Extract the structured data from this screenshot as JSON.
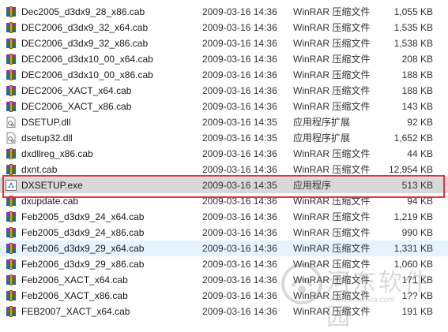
{
  "files": [
    {
      "name": "Dec2005_d3dx9_28_x86.cab",
      "date": "2009-03-16 14:36",
      "type": "WinRAR 压缩文件",
      "size": "1,055 KB",
      "icon": "winrar-archive-icon",
      "state": ""
    },
    {
      "name": "DEC2006_d3dx9_32_x64.cab",
      "date": "2009-03-16 14:36",
      "type": "WinRAR 压缩文件",
      "size": "1,535 KB",
      "icon": "winrar-archive-icon",
      "state": ""
    },
    {
      "name": "DEC2006_d3dx9_32_x86.cab",
      "date": "2009-03-16 14:36",
      "type": "WinRAR 压缩文件",
      "size": "1,538 KB",
      "icon": "winrar-archive-icon",
      "state": ""
    },
    {
      "name": "DEC2006_d3dx10_00_x64.cab",
      "date": "2009-03-16 14:36",
      "type": "WinRAR 压缩文件",
      "size": "208 KB",
      "icon": "winrar-archive-icon",
      "state": ""
    },
    {
      "name": "DEC2006_d3dx10_00_x86.cab",
      "date": "2009-03-16 14:36",
      "type": "WinRAR 压缩文件",
      "size": "188 KB",
      "icon": "winrar-archive-icon",
      "state": ""
    },
    {
      "name": "DEC2006_XACT_x64.cab",
      "date": "2009-03-16 14:36",
      "type": "WinRAR 压缩文件",
      "size": "188 KB",
      "icon": "winrar-archive-icon",
      "state": ""
    },
    {
      "name": "DEC2006_XACT_x86.cab",
      "date": "2009-03-16 14:36",
      "type": "WinRAR 压缩文件",
      "size": "143 KB",
      "icon": "winrar-archive-icon",
      "state": ""
    },
    {
      "name": "DSETUP.dll",
      "date": "2009-03-16 14:35",
      "type": "应用程序扩展",
      "size": "92 KB",
      "icon": "dll-file-icon",
      "state": ""
    },
    {
      "name": "dsetup32.dll",
      "date": "2009-03-16 14:35",
      "type": "应用程序扩展",
      "size": "1,652 KB",
      "icon": "dll-file-icon",
      "state": ""
    },
    {
      "name": "dxdllreg_x86.cab",
      "date": "2009-03-16 14:36",
      "type": "WinRAR 压缩文件",
      "size": "44 KB",
      "icon": "winrar-archive-icon",
      "state": ""
    },
    {
      "name": "dxnt.cab",
      "date": "2009-03-16 14:36",
      "type": "WinRAR 压缩文件",
      "size": "12,954 KB",
      "icon": "winrar-archive-icon",
      "state": ""
    },
    {
      "name": "DXSETUP.exe",
      "date": "2009-03-16 14:35",
      "type": "应用程序",
      "size": "513 KB",
      "icon": "dxsetup-exe-icon",
      "state": "selected"
    },
    {
      "name": "dxupdate.cab",
      "date": "2009-03-16 14:36",
      "type": "WinRAR 压缩文件",
      "size": "94 KB",
      "icon": "winrar-archive-icon",
      "state": ""
    },
    {
      "name": "Feb2005_d3dx9_24_x64.cab",
      "date": "2009-03-16 14:36",
      "type": "WinRAR 压缩文件",
      "size": "1,219 KB",
      "icon": "winrar-archive-icon",
      "state": ""
    },
    {
      "name": "Feb2005_d3dx9_24_x86.cab",
      "date": "2009-03-16 14:36",
      "type": "WinRAR 压缩文件",
      "size": "990 KB",
      "icon": "winrar-archive-icon",
      "state": ""
    },
    {
      "name": "Feb2006_d3dx9_29_x64.cab",
      "date": "2009-03-16 14:36",
      "type": "WinRAR 压缩文件",
      "size": "1,331 KB",
      "icon": "winrar-archive-icon",
      "state": "hovered"
    },
    {
      "name": "Feb2006_d3dx9_29_x86.cab",
      "date": "2009-03-16 14:36",
      "type": "WinRAR 压缩文件",
      "size": "1,060 KB",
      "icon": "winrar-archive-icon",
      "state": ""
    },
    {
      "name": "Feb2006_XACT_x64.cab",
      "date": "2009-03-16 14:36",
      "type": "WinRAR 压缩文件",
      "size": "171 KB",
      "icon": "winrar-archive-icon",
      "state": ""
    },
    {
      "name": "Feb2006_XACT_x86.cab",
      "date": "2009-03-16 14:36",
      "type": "WinRAR 压缩文件",
      "size": "1?? KB",
      "icon": "winrar-archive-icon",
      "state": ""
    },
    {
      "name": "FEB2007_XACT_x64.cab",
      "date": "2009-03-16 14:36",
      "type": "WinRAR 压缩文件",
      "size": "191 KB",
      "icon": "winrar-archive-icon",
      "state": ""
    }
  ],
  "watermark": {
    "text": "河东软件园",
    "url": "www.downxia.com"
  },
  "colors": {
    "highlight_border": "#e8303c",
    "selected_row": "#d9d9d9",
    "hover_row": "#e5f3ff"
  }
}
